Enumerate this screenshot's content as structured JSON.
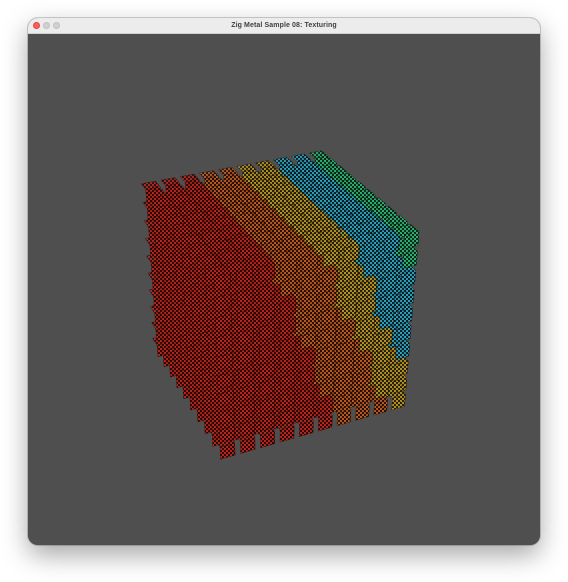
{
  "window": {
    "title": "Zig Metal Sample 08: Texturing",
    "background_color": "#4f4f4f",
    "traffic_lights": {
      "close": {
        "icon": "close-icon",
        "color": "#ff5f57"
      },
      "minimize": {
        "icon": "minimize-icon",
        "color": "#d1d1d1"
      },
      "zoom": {
        "icon": "zoom-icon",
        "color": "#d1d1d1"
      }
    }
  },
  "render": {
    "content": "rotating grid of checker-textured cubes",
    "colors": {
      "face_red": "#c8281e",
      "face_orange": "#c8641e",
      "face_yellow": "#c8a01e",
      "face_cyan": "#28b4c8",
      "face_green": "#28c878",
      "checker_dark": "#1a0a08"
    }
  }
}
